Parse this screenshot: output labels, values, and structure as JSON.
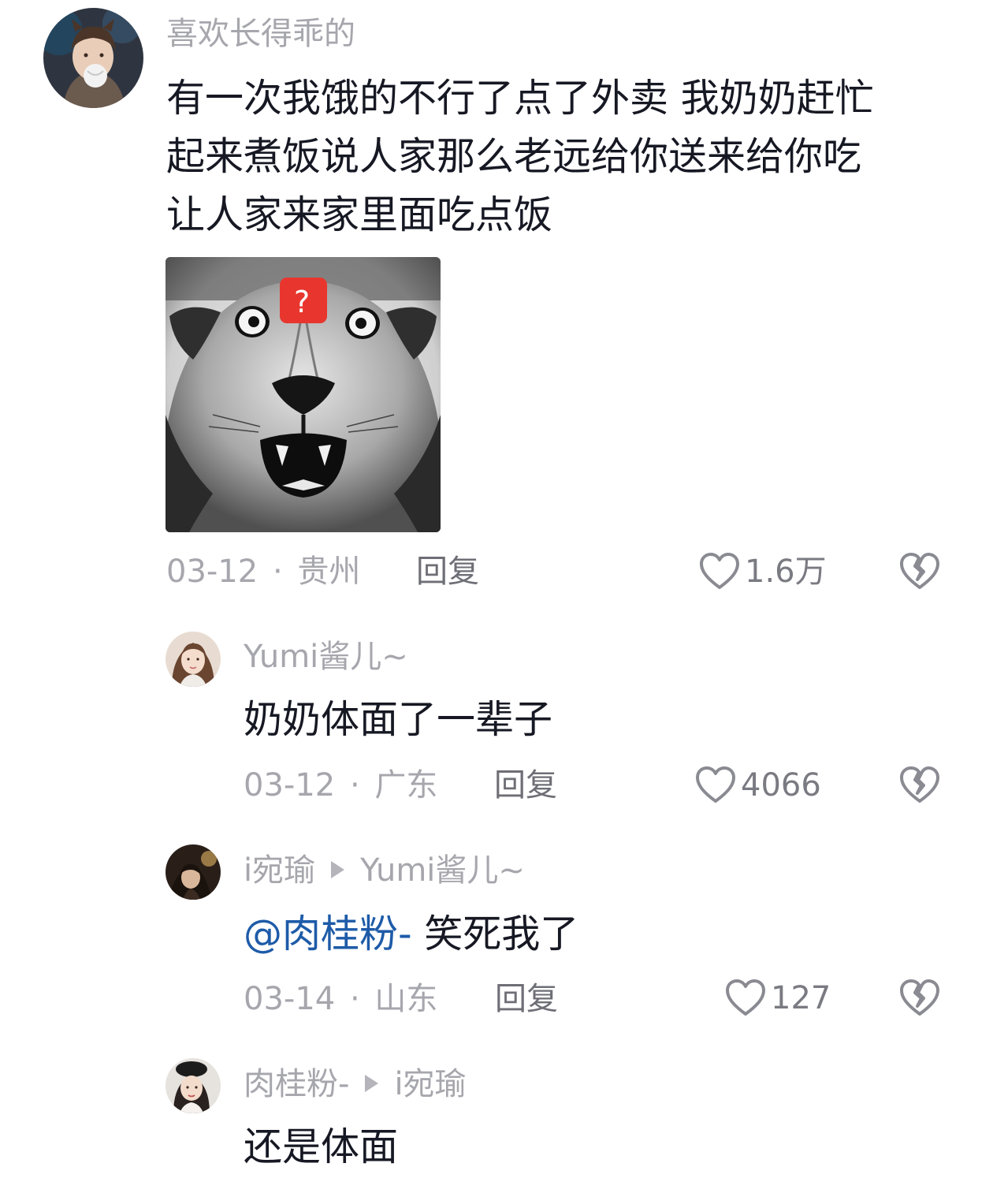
{
  "comments": [
    {
      "username": "喜欢长得乖的",
      "text_lines": [
        "有一次我饿的不行了点了外卖 我奶奶赶忙",
        "起来煮饭说人家那么老远给你送来给你吃",
        "让人家来家里面吃点饭"
      ],
      "sticker_badge": "?",
      "date": "03-12",
      "separator": "·",
      "location": "贵州",
      "reply_label": "回复",
      "likes": "1.6万"
    },
    {
      "username": "Yumi酱儿~",
      "text": "奶奶体面了一辈子",
      "date": "03-12",
      "separator": "·",
      "location": "广东",
      "reply_label": "回复",
      "likes": "4066"
    },
    {
      "username": "i宛瑜",
      "reply_to": "Yumi酱儿~",
      "mention": "@肉桂粉-",
      "text": " 笑死我了",
      "date": "03-14",
      "separator": "·",
      "location": "山东",
      "reply_label": "回复",
      "likes": "127"
    },
    {
      "username": "肉桂粉-",
      "reply_to": "i宛瑜",
      "text": "还是体面"
    }
  ],
  "colors": {
    "text": "#161823",
    "muted": "#a6a6ad",
    "mention": "#1e5ba8",
    "badge": "#e8362f"
  },
  "icons": {
    "like": "heart-outline-icon",
    "dislike": "broken-heart-icon",
    "reply_arrow": "play-triangle-icon"
  }
}
